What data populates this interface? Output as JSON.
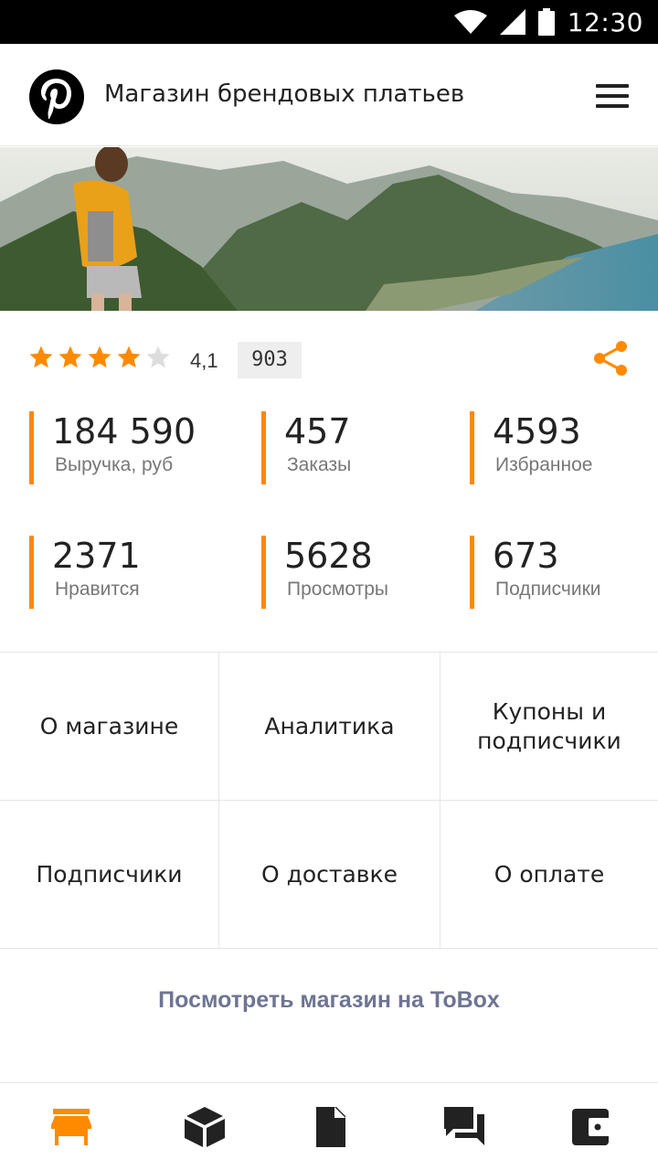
{
  "status_bar": {
    "time": "12:30"
  },
  "header": {
    "title": "Магазин брендовых платьев"
  },
  "rating": {
    "value": "4,1",
    "stars_filled": 4,
    "stars_total": 5,
    "reviews_count": "903"
  },
  "stats": [
    {
      "value": "184 590",
      "label": "Выручка, руб"
    },
    {
      "value": "457",
      "label": "Заказы"
    },
    {
      "value": "4593",
      "label": "Избранное"
    },
    {
      "value": "2371",
      "label": "Нравится"
    },
    {
      "value": "5628",
      "label": "Просмотры"
    },
    {
      "value": "673",
      "label": "Подписчики"
    }
  ],
  "menu_grid": [
    {
      "label": "О магазине"
    },
    {
      "label": "Аналитика"
    },
    {
      "label": "Купоны и\nподписчики"
    },
    {
      "label": "Подписчики"
    },
    {
      "label": "О доставке"
    },
    {
      "label": "О оплате"
    }
  ],
  "tobox_link": "Посмотреть магазин на ToBox",
  "bottom_nav": [
    {
      "icon": "store-icon",
      "active": true
    },
    {
      "icon": "box-icon",
      "active": false
    },
    {
      "icon": "document-icon",
      "active": false
    },
    {
      "icon": "chat-icon",
      "active": false
    },
    {
      "icon": "wallet-icon",
      "active": false
    }
  ],
  "colors": {
    "accent": "#ff8a00",
    "link": "#6e7493",
    "inactive_icon": "#222222",
    "divider": "#e6e6e6"
  }
}
